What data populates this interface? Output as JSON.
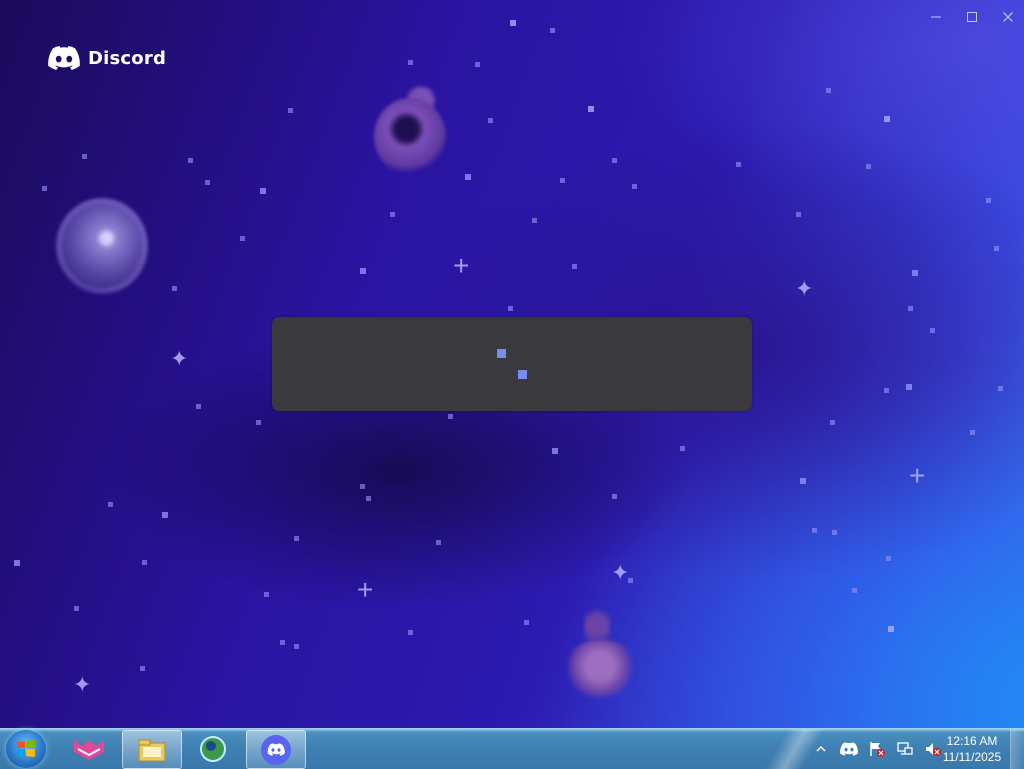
{
  "app": {
    "name": "Discord",
    "logo_icon": "discord-logo-icon",
    "window_controls": [
      "minimize-icon",
      "maximize-icon",
      "close-icon"
    ]
  },
  "loading": {
    "state": "loading",
    "indicator_color": "#7a8bf0",
    "panel_color": "#3a3a3e"
  },
  "taskbar": {
    "start_icon": "windows-start-icon",
    "pinned": [
      {
        "name": "app-icon",
        "active": false
      },
      {
        "name": "file-explorer-icon",
        "active": true
      },
      {
        "name": "browser-icon",
        "active": false
      },
      {
        "name": "discord-icon",
        "active": true
      }
    ],
    "tray_icons": [
      "show-hidden-icons-chevron",
      "discord-tray-icon",
      "action-center-flag-icon",
      "network-icon",
      "volume-muted-icon"
    ],
    "clock": {
      "time": "12:16 AM",
      "date": "11/11/2025"
    }
  },
  "colors": {
    "background_start": "#1b0a5a",
    "background_end": "#3b78f0",
    "accent": "#5865f2"
  }
}
